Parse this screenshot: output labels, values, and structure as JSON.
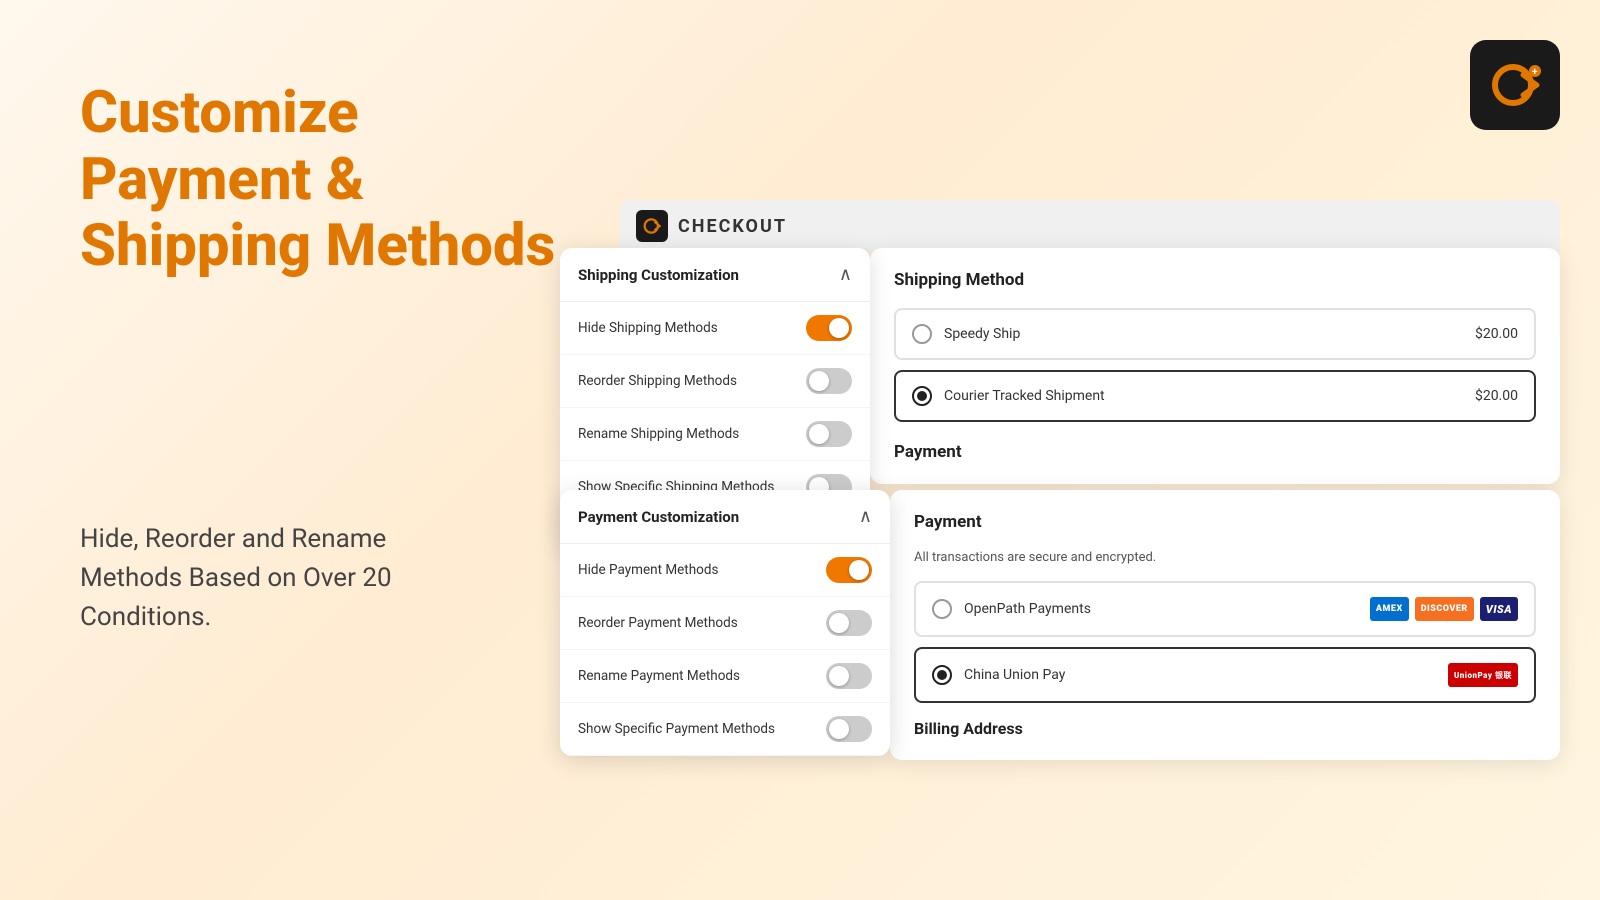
{
  "hero": {
    "title": "Customize Payment & Shipping Methods",
    "subtitle": "Hide, Reorder and Rename Methods Based on Over 20 Conditions."
  },
  "logo": {
    "alt": "Checkout Plus Logo"
  },
  "checkout_bar": {
    "title": "CHECKOUT"
  },
  "shipping_customization": {
    "panel_title": "Shipping Customization",
    "rows": [
      {
        "label": "Hide Shipping Methods",
        "toggle": "on"
      },
      {
        "label": "Reorder Shipping Methods",
        "toggle": "off"
      },
      {
        "label": "Rename Shipping Methods",
        "toggle": "off"
      },
      {
        "label": "Show Specific Shipping Methods",
        "toggle": "off"
      }
    ]
  },
  "shipping_method": {
    "title": "Shipping Method",
    "options": [
      {
        "label": "Speedy Ship",
        "price": "$20.00",
        "selected": false
      },
      {
        "label": "Courier Tracked Shipment",
        "price": "$20.00",
        "selected": true
      }
    ],
    "payment_title": "Payment"
  },
  "payment_customization": {
    "panel_title": "Payment Customization",
    "rows": [
      {
        "label": "Hide Payment Methods",
        "toggle": "on"
      },
      {
        "label": "Reorder Payment Methods",
        "toggle": "off"
      },
      {
        "label": "Rename Payment Methods",
        "toggle": "off"
      },
      {
        "label": "Show Specific Payment Methods",
        "toggle": "off"
      }
    ]
  },
  "payment_method": {
    "title": "Payment",
    "secure_text": "All transactions are secure and encrypted.",
    "options": [
      {
        "label": "OpenPath Payments",
        "selected": false,
        "badges": [
          "AMEX",
          "DISCOVER",
          "VISA"
        ]
      },
      {
        "label": "China Union Pay",
        "selected": true,
        "badges": [
          "UnionPay"
        ]
      }
    ],
    "billing_title": "Billing Address"
  }
}
